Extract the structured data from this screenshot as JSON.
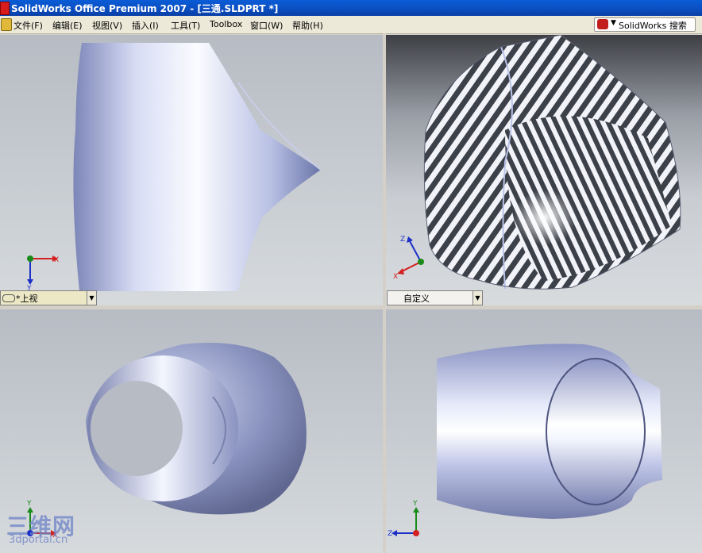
{
  "window": {
    "title": "SolidWorks Office Premium 2007 - [三通.SLDPRT *]"
  },
  "menu": {
    "items": [
      "文件(F)",
      "编辑(E)",
      "视图(V)",
      "插入(I)",
      "工具(T)",
      "Toolbox",
      "窗口(W)",
      "帮助(H)"
    ]
  },
  "search": {
    "label": "SolidWorks 搜索"
  },
  "viewports": {
    "top_left": {
      "view_name": "*上视",
      "triad": {
        "x": "X",
        "y": "Y"
      }
    },
    "top_right": {
      "view_name": "自定义",
      "triad": {
        "x": "X",
        "y": "Y",
        "z": "Z"
      }
    },
    "bottom_left": {
      "triad": {
        "x": "X",
        "y": "Y"
      }
    },
    "bottom_right": {
      "triad": {
        "y": "Y",
        "z": "Z"
      }
    }
  },
  "watermark": {
    "main": "三维网",
    "sub": "3dportal.cn"
  },
  "colors": {
    "titlebar": "#0a5cd6",
    "model_blue": "#aab4e0",
    "axis_red": "#d42020",
    "axis_green": "#1a8a1a",
    "axis_blue": "#1c30c8"
  },
  "icons": [
    "solidworks-app-icon",
    "document-icon",
    "solidworks-search-icon",
    "glasses-icon",
    "dropdown-arrow-icon"
  ]
}
